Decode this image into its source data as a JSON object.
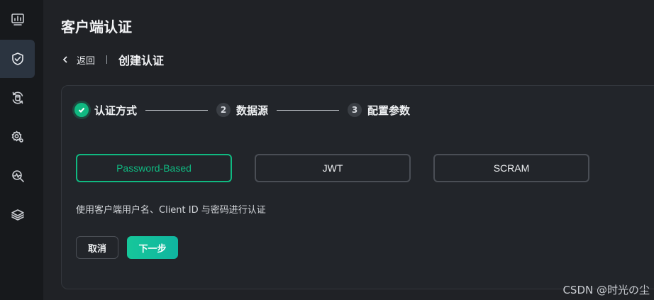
{
  "header": {
    "title": "客户端认证"
  },
  "breadcrumb": {
    "back_label": "返回",
    "current": "创建认证"
  },
  "sidebar": {
    "items": [
      {
        "icon": "dashboard-chart-icon"
      },
      {
        "icon": "shield-check-icon",
        "active": true
      },
      {
        "icon": "data-sync-icon"
      },
      {
        "icon": "gear-cog-icon"
      },
      {
        "icon": "monitor-search-icon"
      },
      {
        "icon": "layers-icon"
      }
    ]
  },
  "steps": [
    {
      "number": "",
      "label": "认证方式",
      "status": "done"
    },
    {
      "number": "2",
      "label": "数据源",
      "status": "pending"
    },
    {
      "number": "3",
      "label": "配置参数",
      "status": "pending"
    }
  ],
  "auth_options": [
    {
      "label": "Password-Based",
      "selected": true
    },
    {
      "label": "JWT",
      "selected": false
    },
    {
      "label": "SCRAM",
      "selected": false
    }
  ],
  "description": "使用客户端用户名、Client ID 与密码进行认证",
  "actions": {
    "cancel_label": "取消",
    "next_label": "下一步"
  },
  "colors": {
    "accent": "#10b981",
    "background": "#202226",
    "sidebar": "#17191c"
  },
  "watermark": "CSDN @时光の尘"
}
